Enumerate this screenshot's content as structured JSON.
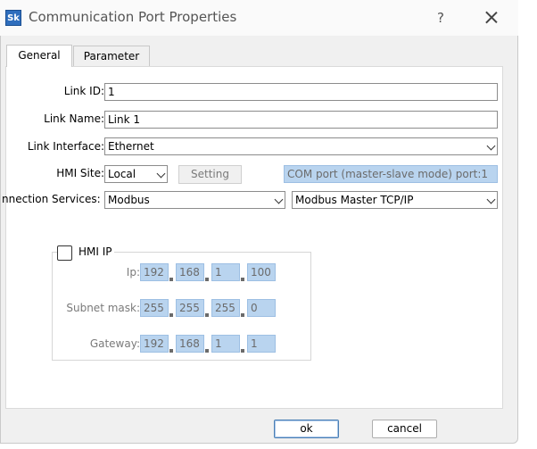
{
  "window": {
    "app_icon_text": "Sk",
    "title": "Communication Port Properties",
    "help_glyph": "?"
  },
  "tabs": [
    {
      "label": "General",
      "active": true
    },
    {
      "label": "Parameter",
      "active": false
    }
  ],
  "general": {
    "link_id": {
      "label": "Link ID:",
      "value": "1"
    },
    "link_name": {
      "label": "Link Name:",
      "value": "Link 1"
    },
    "link_interface": {
      "label": "Link Interface:",
      "value": "Ethernet"
    },
    "hmi_site": {
      "label": "HMI Site:",
      "value": "Local",
      "setting_label": "Setting",
      "com_port_text": "COM port (master-slave mode) port:1"
    },
    "connection_services": {
      "label": "nnection Services:",
      "service": "Modbus",
      "protocol": "Modbus Master TCP/IP"
    }
  },
  "hmi_ip": {
    "checkbox_label": "HMI IP",
    "checked": false,
    "ip": {
      "label": "Ip:",
      "octets": [
        "192",
        "168",
        "1",
        "100"
      ]
    },
    "subnet": {
      "label": "Subnet mask:",
      "octets": [
        "255",
        "255",
        "255",
        "0"
      ]
    },
    "gateway": {
      "label": "Gateway:",
      "octets": [
        "192",
        "168",
        "1",
        "1"
      ]
    }
  },
  "footer": {
    "ok_label": "ok",
    "cancel_label": "cancel"
  },
  "colors": {
    "readonly_fill": "#b9d4ef",
    "dialog_bg": "#f0f0f0"
  }
}
